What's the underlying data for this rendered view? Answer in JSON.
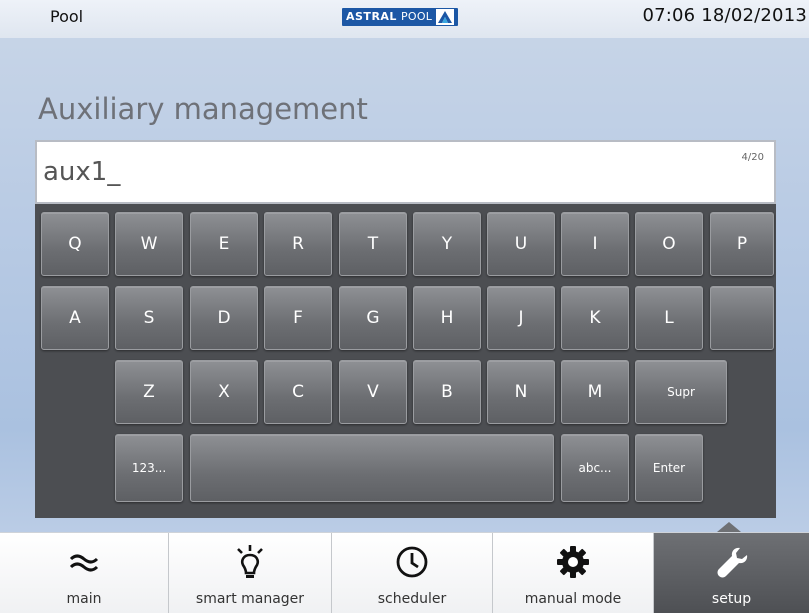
{
  "status": {
    "left": "Pool",
    "datetime": "07:06  18/02/2013",
    "logo_bold": "ASTRAL",
    "logo_light": "POOL"
  },
  "heading": "Auxiliary management",
  "input": {
    "value": "aux1_",
    "counter": "4/20"
  },
  "keyboard": {
    "row1": [
      "Q",
      "W",
      "E",
      "R",
      "T",
      "Y",
      "U",
      "I",
      "O",
      "P"
    ],
    "row2": [
      "A",
      "S",
      "D",
      "F",
      "G",
      "H",
      "J",
      "K",
      "L",
      ""
    ],
    "row3": [
      "Z",
      "X",
      "C",
      "V",
      "B",
      "N",
      "M"
    ],
    "supr": "Supr",
    "numbers": "123...",
    "abc": "abc...",
    "enter": "Enter",
    "space": ""
  },
  "nav": [
    {
      "label": "main",
      "icon": "approx-wave-icon"
    },
    {
      "label": "smart manager",
      "icon": "lightbulb-icon"
    },
    {
      "label": "scheduler",
      "icon": "clock-icon"
    },
    {
      "label": "manual mode",
      "icon": "gear-icon"
    },
    {
      "label": "setup",
      "icon": "wrench-icon",
      "active": true
    }
  ],
  "colors": {
    "brand": "#1c57a5",
    "keyboard_bg": "#4c4e52",
    "nav_active": "#5e6064"
  }
}
